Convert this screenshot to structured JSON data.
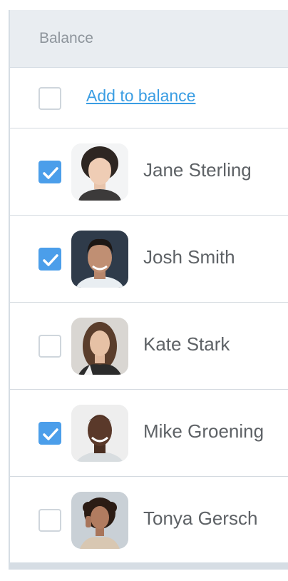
{
  "header": {
    "title": "Balance"
  },
  "add_row": {
    "link_label": "Add to balance",
    "checked": false
  },
  "people": [
    {
      "name": "Jane Sterling",
      "checked": true,
      "avatar": "woman-portrait-1"
    },
    {
      "name": "Josh Smith",
      "checked": true,
      "avatar": "man-portrait-1"
    },
    {
      "name": "Kate Stark",
      "checked": false,
      "avatar": "woman-portrait-2"
    },
    {
      "name": "Mike Groening",
      "checked": true,
      "avatar": "man-portrait-2"
    },
    {
      "name": "Tonya Gersch",
      "checked": false,
      "avatar": "woman-portrait-3"
    }
  ],
  "colors": {
    "accent": "#4b9eea",
    "link": "#3a9de3",
    "header_bg": "#e9edf1"
  }
}
